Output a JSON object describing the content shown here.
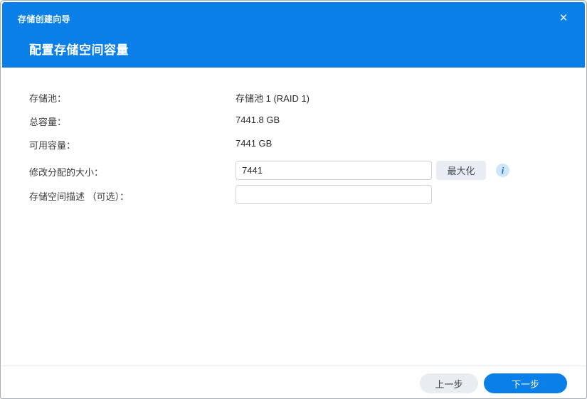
{
  "dialog": {
    "title": "存储创建向导",
    "heading": "配置存储空间容量"
  },
  "icons": {
    "close": "✕",
    "info": "i"
  },
  "form": {
    "rows": [
      {
        "label": "存储池：",
        "value": "存储池 1 (RAID 1)"
      },
      {
        "label": "总容量：",
        "value": "7441.8 GB"
      },
      {
        "label": "可用容量：",
        "value": "7441 GB"
      }
    ],
    "size_field": {
      "label": "修改分配的大小：",
      "value": "7441",
      "max_button": "最大化"
    },
    "desc_field": {
      "label": "存储空间描述 （可选）：",
      "value": "",
      "placeholder": ""
    }
  },
  "footer": {
    "back_label": "上一步",
    "next_label": "下一步"
  },
  "colors": {
    "accent_blue": "#0a7fe8",
    "button_gray": "#e9edf3",
    "input_border": "#cdd4dc",
    "info_icon_bg": "#cfe6fa",
    "info_icon_fg": "#0c76cf"
  }
}
